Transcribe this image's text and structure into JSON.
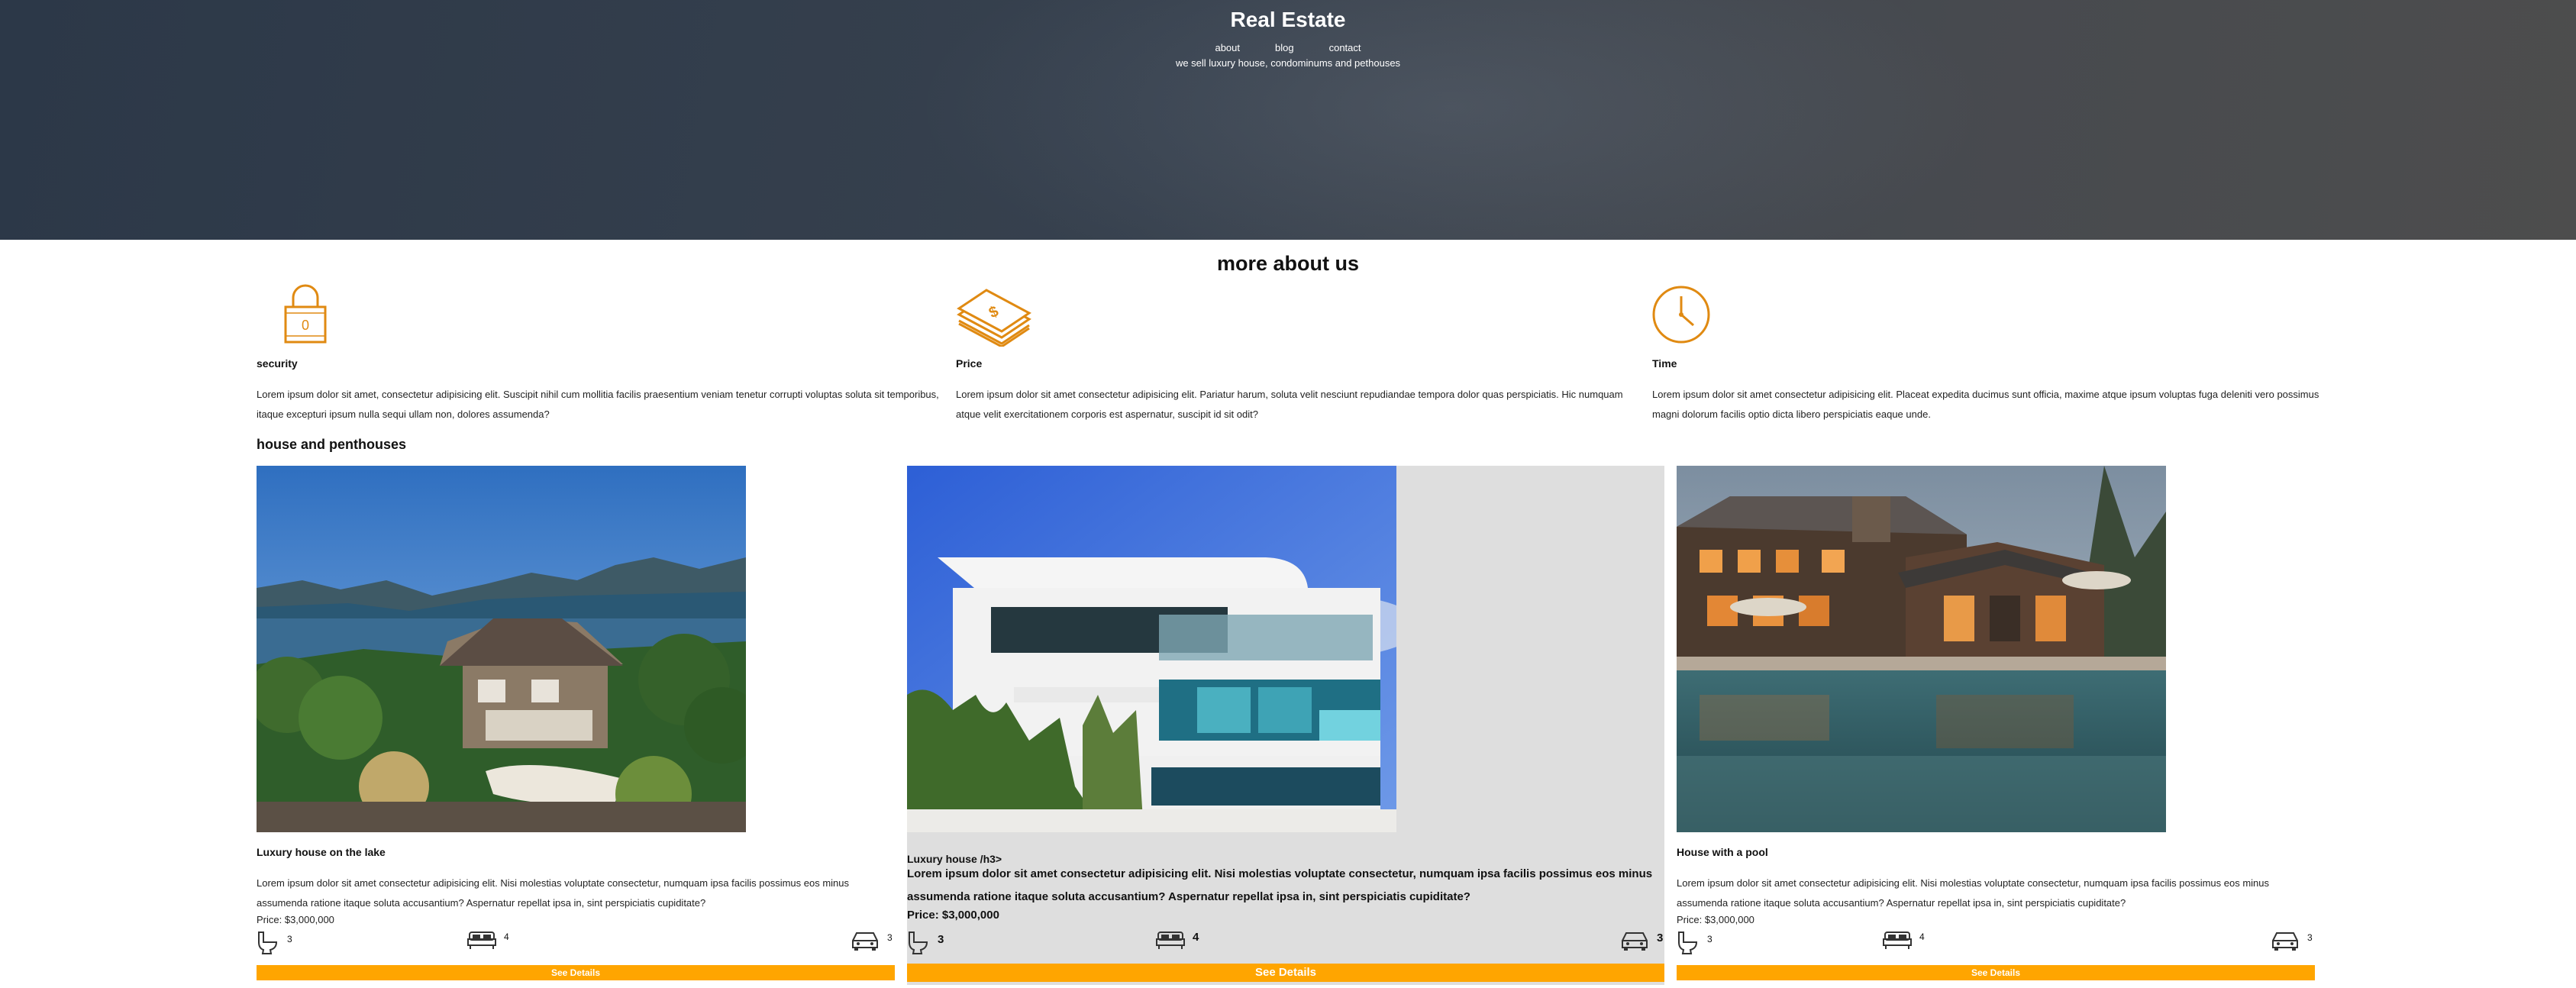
{
  "hero": {
    "title": "Real Estate",
    "nav": [
      "about",
      "blog",
      "contact"
    ],
    "subtitle": "we sell luxury house, condominums and pethouses"
  },
  "about": {
    "title": "more about us",
    "features": [
      {
        "icon": "lock-icon",
        "name": "security",
        "text": "Lorem ipsum dolor sit amet, consectetur adipisicing elit. Suscipit nihil cum mollitia facilis praesentium veniam tenetur corrupti voluptas soluta sit temporibus, itaque excepturi ipsum nulla sequi ullam non, dolores assumenda?"
      },
      {
        "icon": "money-icon",
        "name": "Price",
        "text": "Lorem ipsum dolor sit amet consectetur adipisicing elit. Pariatur harum, soluta velit nesciunt repudiandae tempora dolor quas perspiciatis. Hic numquam atque velit exercitationem corporis est aspernatur, suscipit id sit odit?"
      },
      {
        "icon": "clock-icon",
        "name": "Time",
        "text": "Lorem ipsum dolor sit amet consectetur adipisicing elit. Placeat expedita ducimus sunt officia, maxime atque ipsum voluptas fuga deleniti vero possimus magni dolorum facilis optio dicta libero perspiciatis eaque unde."
      }
    ]
  },
  "listings": {
    "title": "house and penthouses",
    "cards": [
      {
        "title": "Luxury house on the lake",
        "desc": "Lorem ipsum dolor sit amet consectetur adipisicing elit. Nisi molestias voluptate consectetur, numquam ipsa facilis possimus eos minus assumenda ratione itaque soluta accusantium? Aspernatur repellat ipsa in, sint perspiciatis cupiditate?",
        "price": "Price: $3,000,000",
        "baths": "3",
        "beds": "4",
        "cars": "3",
        "button": "See Details"
      },
      {
        "title": "Luxury house /h3>",
        "desc": "Lorem ipsum dolor sit amet consectetur adipisicing elit. Nisi molestias voluptate consectetur, numquam ipsa facilis possimus eos minus assumenda ratione itaque soluta accusantium? Aspernatur repellat ipsa in, sint perspiciatis cupiditate?",
        "price": "Price: $3,000,000",
        "baths": "3",
        "beds": "4",
        "cars": "3",
        "button": "See Details"
      },
      {
        "title": "House with a pool",
        "desc": "Lorem ipsum dolor sit amet consectetur adipisicing elit. Nisi molestias voluptate consectetur, numquam ipsa facilis possimus eos minus assumenda ratione itaque soluta accusantium? Aspernatur repellat ipsa in, sint perspiciatis cupiditate?",
        "price": "Price: $3,000,000",
        "baths": "3",
        "beds": "4",
        "cars": "3",
        "button": "See Details"
      }
    ]
  },
  "colors": {
    "accent": "#ffa500",
    "icon": "#e08a12",
    "hero": "#37414e"
  }
}
